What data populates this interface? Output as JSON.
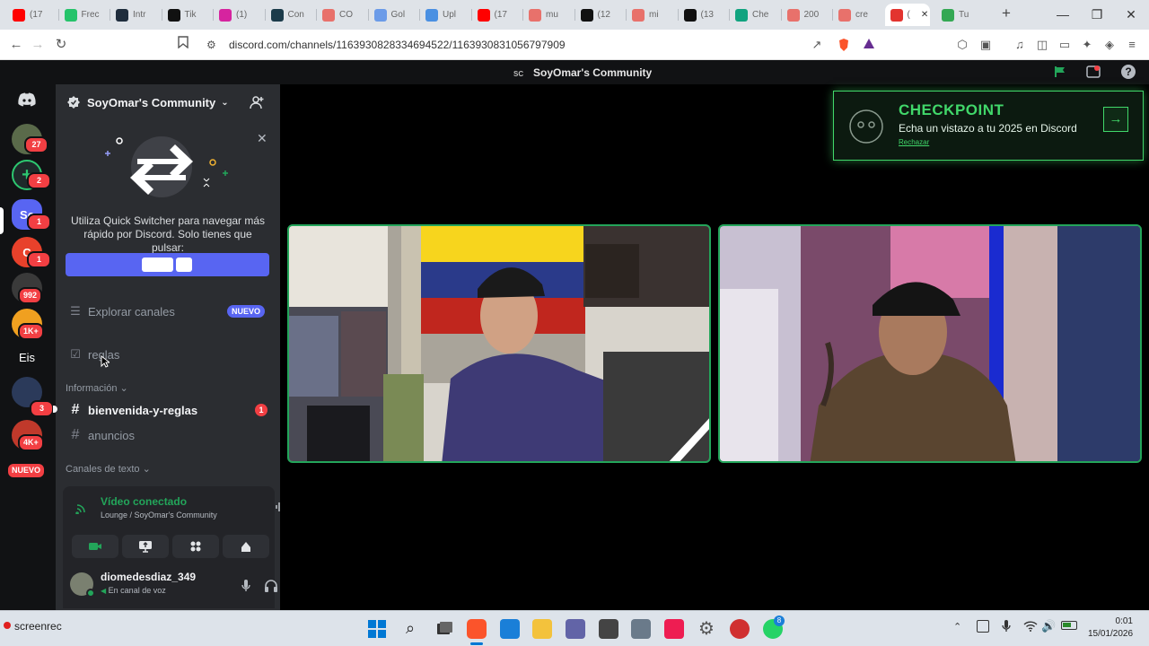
{
  "browser": {
    "tabs": [
      {
        "label": "(17",
        "color": "#ff0000"
      },
      {
        "label": "Frec",
        "color": "#25c36a"
      },
      {
        "label": "Intr",
        "color": "#1f2d3d"
      },
      {
        "label": "Tik",
        "color": "#111111"
      },
      {
        "label": "(1)",
        "color": "#d6249f"
      },
      {
        "label": "Con",
        "color": "#1b3b4a"
      },
      {
        "label": "CO",
        "color": "#e8716b"
      },
      {
        "label": "Gol",
        "color": "#6b9be8"
      },
      {
        "label": "Upl",
        "color": "#4a90e2"
      },
      {
        "label": "(17",
        "color": "#ff0000"
      },
      {
        "label": "mu",
        "color": "#e8716b"
      },
      {
        "label": "(12",
        "color": "#111111"
      },
      {
        "label": "mi",
        "color": "#e8716b"
      },
      {
        "label": "(13",
        "color": "#111111"
      },
      {
        "label": "Che",
        "color": "#10a37f"
      },
      {
        "label": "200",
        "color": "#e8716b"
      },
      {
        "label": "cre",
        "color": "#e8716b"
      },
      {
        "label": "(",
        "color": "#e3342f"
      },
      {
        "label": "Tu",
        "color": "#34a853"
      }
    ],
    "new_tab": "+",
    "url_site_icon": "⚙",
    "url": "discord.com/channels/1163930828334694522/1163930831056797909"
  },
  "discord": {
    "server_name": "SoyOmar's Community",
    "server_abbr": "SC",
    "rail": {
      "badges": [
        "27",
        "2",
        "1",
        "1",
        "992",
        "1K+",
        "3",
        "4K+"
      ],
      "eis": "Eis",
      "new_label": "NUEVO",
      "sc_label": "Sc"
    },
    "sidebar": {
      "title": "SoyOmar's Community",
      "quick_switcher_text": "Utiliza Quick Switcher para navegar más rápido por Discord. Solo tienes que pulsar:",
      "explore": "Explorar canales",
      "explore_badge": "NUEVO",
      "channel_reglas": "reglas",
      "category_info": "Información",
      "channel_bienvenida": "bienvenida-y-reglas",
      "bienvenida_badge": "1",
      "channel_anuncios": "anuncios",
      "category_text": "Canales de texto"
    },
    "voice": {
      "status": "Vídeo conectado",
      "location": "Lounge / SoyOmar's Community"
    },
    "user": {
      "name": "diomedesdiaz_349",
      "status": "En canal de voz"
    },
    "checkpoint": {
      "title": "CHECKPOINT",
      "subtitle": "Echa un vistazo a tu 2025 en Discord",
      "dismiss": "Rechazar"
    }
  },
  "taskbar": {
    "left_label": "screenrec",
    "time": "0:01",
    "date": "15/01/2026",
    "whatsapp_badge": "8"
  },
  "colors": {
    "discord_blurple": "#5865f2",
    "discord_green": "#23a55a",
    "badge_red": "#f23f43",
    "checkpoint_green": "#41d86a"
  }
}
